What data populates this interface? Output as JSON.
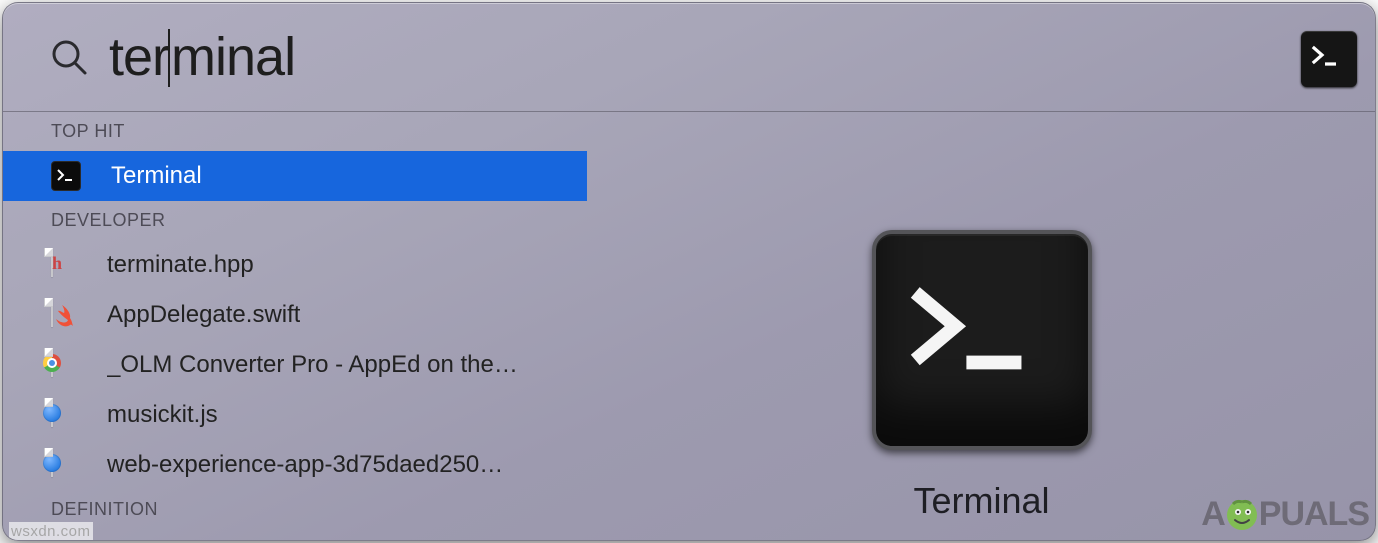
{
  "search": {
    "query_before_caret": "ter",
    "query_after_caret": "minal"
  },
  "sections": {
    "top_hit_label": "TOP HIT",
    "developer_label": "DEVELOPER",
    "definition_label": "DEFINITION"
  },
  "results": {
    "top_hit": {
      "label": "Terminal",
      "icon": "terminal-icon"
    },
    "developer": [
      {
        "label": "terminate.hpp",
        "icon": "header-file-icon"
      },
      {
        "label": "AppDelegate.swift",
        "icon": "swift-file-icon"
      },
      {
        "label": "_OLM Converter Pro - AppEd on the…",
        "icon": "chrome-file-icon"
      },
      {
        "label": "musickit.js",
        "icon": "js-file-icon"
      },
      {
        "label": "web-experience-app-3d75daed250…",
        "icon": "js-file-icon"
      }
    ]
  },
  "preview": {
    "title": "Terminal"
  },
  "watermark": {
    "right_pre": "A",
    "right_post": "PUALS",
    "left": "wsxdn.com"
  }
}
